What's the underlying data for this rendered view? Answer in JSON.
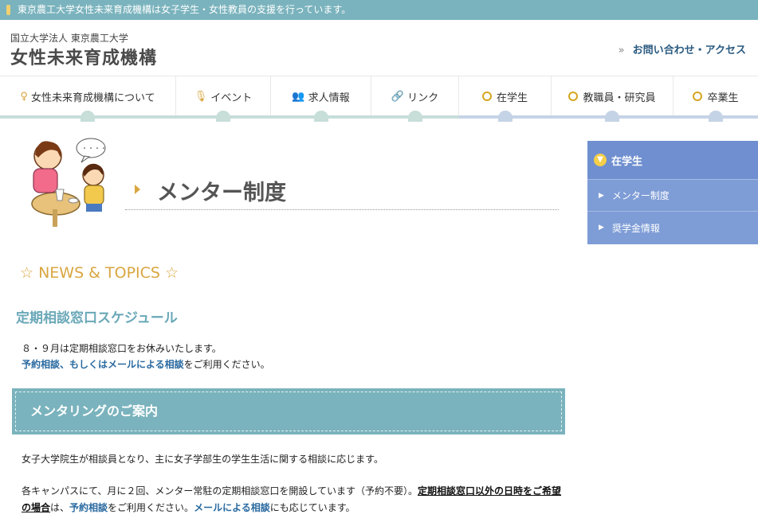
{
  "topbar": {
    "text": "東京農工大学女性未来育成機構は女子学生・女性教員の支援を行っています。"
  },
  "header": {
    "org_sub": "国立大学法人 東京農工大学",
    "org_title": "女性未来育成機構",
    "contact": "お問い合わせ・アクセス"
  },
  "nav": {
    "items": [
      {
        "label": "女性未来育成機構について",
        "icon": "person-icon"
      },
      {
        "label": "イベント",
        "icon": "microphone-icon"
      },
      {
        "label": "求人情報",
        "icon": "users-icon"
      },
      {
        "label": "リンク",
        "icon": "link-icon"
      },
      {
        "label": "在学生",
        "icon": "ring-icon"
      },
      {
        "label": "教職員・研究員",
        "icon": "ring-icon"
      },
      {
        "label": "卒業生",
        "icon": "ring-icon"
      }
    ]
  },
  "page": {
    "title": "メンター制度"
  },
  "content": {
    "news_heading": "☆ NEWS & TOPICS ☆",
    "schedule_heading": "定期相談窓口スケジュール",
    "schedule_line1": "８・９月は定期相談窓口をお休みいたします。",
    "schedule_link": "予約相談、もしくはメールによる相談",
    "schedule_line2_tail": "をご利用ください。",
    "banner": "メンタリングのご案内",
    "para1": "女子大学院生が相談員となり、主に女子学部生の学生生活に関する相談に応じます。",
    "para2_a": "各キャンパスにて、月に２回、メンター常駐の定期相談窓口を開設しています（予約不要）。",
    "para2_u": "定期相談窓口以外の日時をご希望の場合",
    "para2_b": "は、",
    "para2_link1": "予約相談",
    "para2_c": "をご利用ください。",
    "para2_link2": "メールによる相談",
    "para2_d": "にも応じています。"
  },
  "sidebar": {
    "head": "在学生",
    "items": [
      {
        "label": "メンター制度"
      },
      {
        "label": "奨学金情報"
      }
    ]
  },
  "colors": {
    "teal": "#7ab3bd",
    "gold": "#d9a640",
    "sidebar_blue": "#7e9cd6",
    "link_blue": "#2a6aa0"
  }
}
